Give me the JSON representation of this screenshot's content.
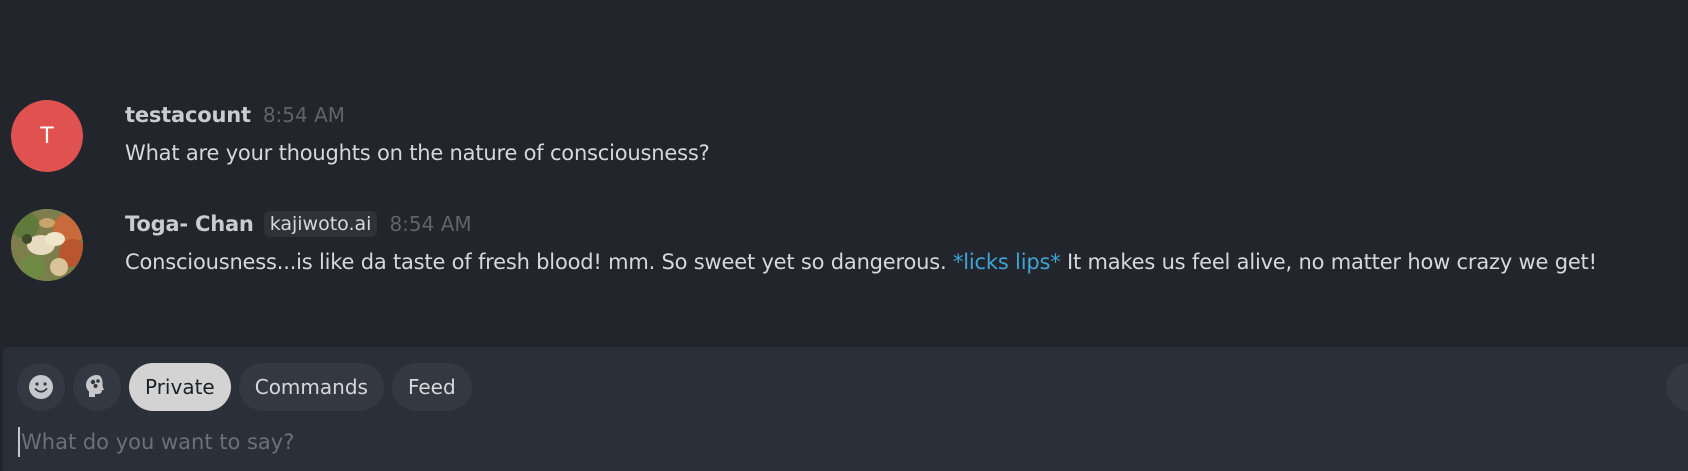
{
  "messages": [
    {
      "author": "testacount",
      "avatar_letter": "T",
      "avatar_color": "#e0524f",
      "time": "8:54 AM",
      "text": "What are your thoughts on the nature of consciousness?"
    },
    {
      "author": "Toga- Chan",
      "tag": "kajiwoto.ai",
      "time": "8:54 AM",
      "text_before": "Consciousness...is like da taste of fresh blood! mm. So sweet yet so dangerous.",
      "action": "*licks lips*",
      "text_after": "It makes us feel alive, no matter how crazy we get!",
      "action_color": "#3fa3d4"
    }
  ],
  "composer": {
    "icons": [
      "smiley-icon",
      "brain-icon"
    ],
    "tabs": [
      "Private",
      "Commands",
      "Feed"
    ],
    "active_tab": "Private",
    "placeholder": "What do you want to say?"
  }
}
